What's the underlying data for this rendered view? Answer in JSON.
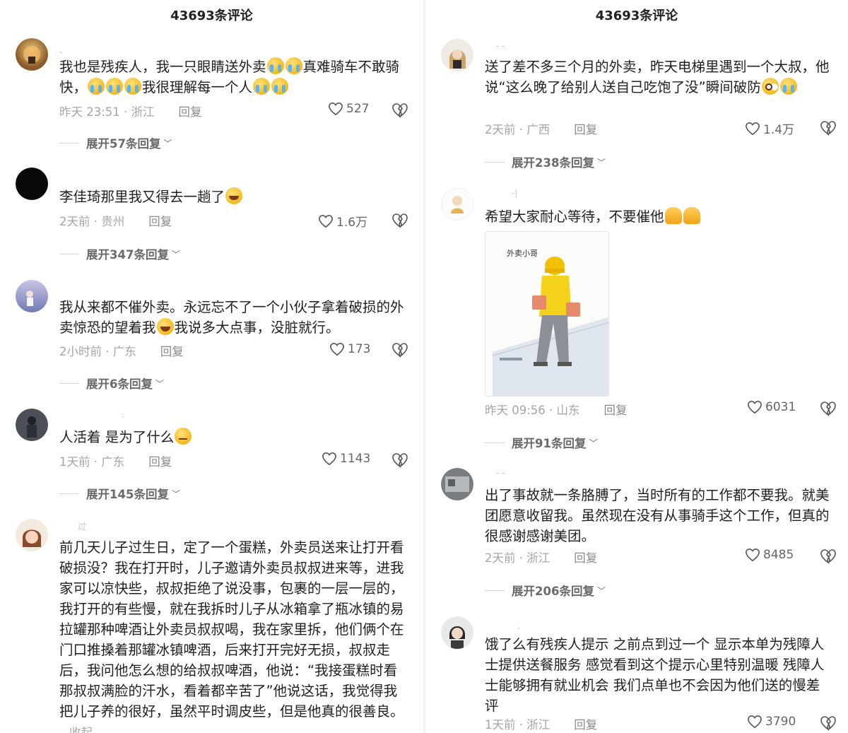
{
  "left_panel": {
    "header": "43693条评论",
    "comments": [
      {
        "text_parts": [
          "我也是残疾人，我一只眼睛送外卖",
          "真难骑车不敢骑快，",
          "我很理解每一个人"
        ],
        "time_location": "昨天 23:51 · 浙江",
        "reply_label": "回复",
        "likes": "527",
        "expand": "展开57条回复"
      },
      {
        "text_parts": [
          "李佳琦那里我又得去一趟了"
        ],
        "time_location": "2天前 · 贵州",
        "reply_label": "回复",
        "likes": "1.6万",
        "expand": "展开347条回复"
      },
      {
        "text_parts": [
          "我从来都不催外卖。永远忘不了一个小伙子拿着破损的外卖惊恐的望着我",
          "我说多大点事，没脏就行。"
        ],
        "time_location": "2小时前 · 广东",
        "reply_label": "回复",
        "likes": "173",
        "expand": "展开6条回复"
      },
      {
        "text_parts": [
          "人活着 是为了什么"
        ],
        "time_location": "1天前 · 广东",
        "reply_label": "回复",
        "likes": "1143",
        "expand": "展开145条回复"
      },
      {
        "username": "过",
        "text": "前几天儿子过生日，定了一个蛋糕，外卖员送来让打开看破损没？我在打开时，儿子邀请外卖员叔叔进来等，进我家可以凉快些，叔叔拒绝了说没事，包裹的一层一层的，我打开的有些慢，就在我拆时儿子从冰箱拿了瓶冰镇的易拉罐那种啤酒让外卖员叔叔喝，我在家里拆，他们俩个在门口推搡着那罐冰镇啤酒，后来打开完好无损，叔叔走后，我问他怎么想的给叔叔啤酒，他说：“我接蛋糕时看那叔叔满脸的汗水，看着都辛苦了”他说这话，我觉得我把儿子养的很好，虽然平时调皮些，但是他真的很善良。",
        "collapse": "收起"
      }
    ]
  },
  "right_panel": {
    "header": "43693条评论",
    "comments": [
      {
        "text_parts": [
          "送了差不多三个月的外卖，昨天电梯里遇到一个大叔，他说“这么晚了给别人送自己吃饱了没”瞬间破防"
        ],
        "time_location": "2天前 · 广西",
        "reply_label": "回复",
        "likes": "1.4万",
        "expand": "展开238条回复"
      },
      {
        "username": "-|",
        "text_parts": [
          "希望大家耐心等待，不要催他"
        ],
        "image_caption": "外卖小哥",
        "time_location": "昨天 09:56 · 山东",
        "reply_label": "回复",
        "likes": "6031",
        "expand": "展开91条回复"
      },
      {
        "text": "出了事故就一条胳膊了，当时所有的工作都不要我。就美团愿意收留我。虽然现在没有从事骑手这个工作，但真的很感谢感谢美团。",
        "time_location": "2天前 · 浙江",
        "reply_label": "回复",
        "likes": "8485",
        "expand": "展开206条回复"
      },
      {
        "text": "饿了么有残疾人提示 之前点到过一个 显示本单为残障人士提供送餐服务 感觉看到这个提示心里特别温暖 残障人士能够拥有就业机会 我们点单也不会因为他们送的慢差评",
        "time_location": "1天前 · 浙江",
        "reply_label": "回复",
        "likes": "3790"
      }
    ]
  },
  "icons": {
    "like": "heart-outline-icon",
    "dislike": "broken-heart-icon",
    "expand_chevron": "chevron-down-icon"
  },
  "colors": {
    "text_primary": "#1f1f1f",
    "text_meta": "#a5a5a5",
    "background": "#ffffff"
  }
}
